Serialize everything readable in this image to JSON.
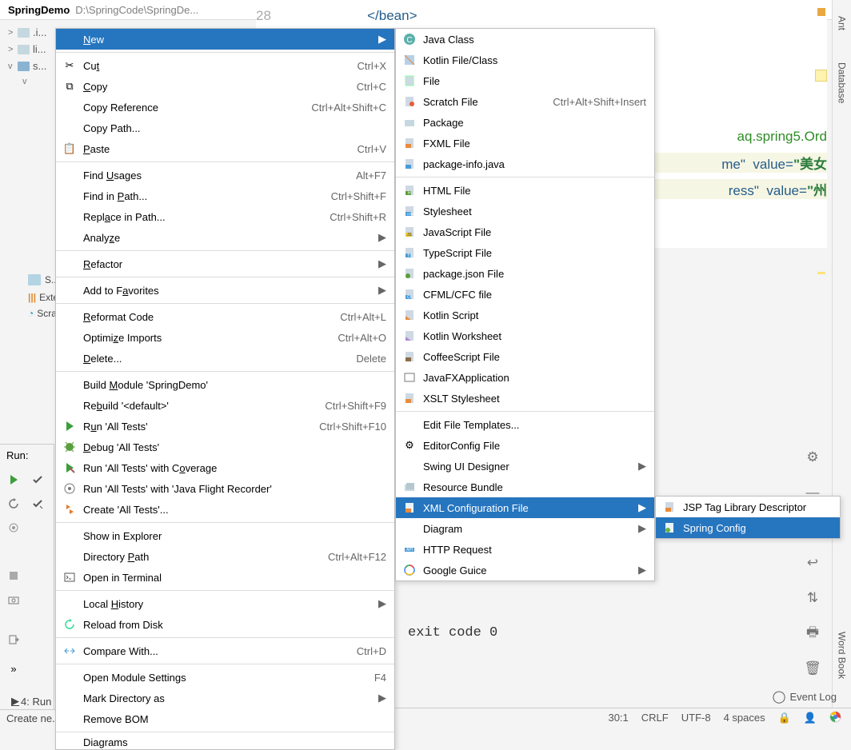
{
  "header": {
    "project": "SpringDemo",
    "path": "D:\\SpringCode\\SpringDe..."
  },
  "tree": {
    "idea": ".i...",
    "lib": "li...",
    "src": "s...",
    "s_label": "S...",
    "external": "Exter...",
    "scratches": "Scrat..."
  },
  "editor": {
    "ln": "28",
    "closebean": "</bean>",
    "pkg": "aq.spring5.Ord",
    "val1": "美女",
    "val2": "州",
    "attr_name": "me\"",
    "attr_addr": "ress\"",
    "kw_value1": "value=",
    "kw_value2": "value="
  },
  "run_panel": {
    "title": "Run:",
    "btn_4run": "4: Run",
    "create": "Create ne..."
  },
  "event_log": "Event Log",
  "status": {
    "pos": "30:1",
    "crlf": "CRLF",
    "enc": "UTF-8",
    "indent": "4 spaces"
  },
  "right_tabs": {
    "ant": "Ant",
    "db": "Database",
    "wb": "Word Book"
  },
  "exit": "exit code 0",
  "ctx": {
    "new": "New",
    "cut": "Cut",
    "copy": "Copy",
    "copyref": "Copy Reference",
    "copypath": "Copy Path...",
    "paste": "Paste",
    "findusages": "Find Usages",
    "findinpath": "Find in Path...",
    "replaceinpath": "Replace in Path...",
    "analyze": "Analyze",
    "refactor": "Refactor",
    "addfav": "Add to Favorites",
    "reformat": "Reformat Code",
    "optimize": "Optimize Imports",
    "delete": "Delete...",
    "buildmod": "Build Module 'SpringDemo'",
    "rebuild": "Rebuild '<default>'",
    "run": "Run 'All Tests'",
    "debug": "Debug 'All Tests'",
    "coverage": "Run 'All Tests' with Coverage",
    "flight": "Run 'All Tests' with 'Java Flight Recorder'",
    "create_tests": "Create 'All Tests'...",
    "showexpl": "Show in Explorer",
    "dirpath": "Directory Path",
    "terminal": "Open in Terminal",
    "localhist": "Local History",
    "reload": "Reload from Disk",
    "compare": "Compare With...",
    "openmod": "Open Module Settings",
    "markdir": "Mark Directory as",
    "removebom": "Remove BOM",
    "diagrams": "Diagrams",
    "sc_cut": "Ctrl+X",
    "sc_copy": "Ctrl+C",
    "sc_copyref": "Ctrl+Alt+Shift+C",
    "sc_paste": "Ctrl+V",
    "sc_findusages": "Alt+F7",
    "sc_findinpath": "Ctrl+Shift+F",
    "sc_replaceinpath": "Ctrl+Shift+R",
    "sc_reformat": "Ctrl+Alt+L",
    "sc_optimize": "Ctrl+Alt+O",
    "sc_delete": "Delete",
    "sc_rebuild": "Ctrl+Shift+F9",
    "sc_run": "Ctrl+Shift+F10",
    "sc_dirpath": "Ctrl+Alt+F12",
    "sc_compare": "Ctrl+D",
    "sc_openmod": "F4"
  },
  "sub": {
    "javaclass": "Java Class",
    "kotlinclass": "Kotlin File/Class",
    "file": "File",
    "scratch": "Scratch File",
    "package": "Package",
    "fxml": "FXML File",
    "pkginfo": "package-info.java",
    "html": "HTML File",
    "stylesheet": "Stylesheet",
    "js": "JavaScript File",
    "ts": "TypeScript File",
    "packagejson": "package.json File",
    "cfml": "CFML/CFC file",
    "kotlinscript": "Kotlin Script",
    "kotlinws": "Kotlin Worksheet",
    "coffeescript": "CoffeeScript File",
    "javafx": "JavaFXApplication",
    "xslt": "XSLT Stylesheet",
    "edittmpl": "Edit File Templates...",
    "editorconfig": "EditorConfig File",
    "swing": "Swing UI Designer",
    "resource": "Resource Bundle",
    "xmlconfig": "XML Configuration File",
    "diagram": "Diagram",
    "httpreq": "HTTP Request",
    "guice": "Google Guice",
    "sc_scratch": "Ctrl+Alt+Shift+Insert"
  },
  "sub2": {
    "jsp": "JSP Tag Library Descriptor",
    "spring": "Spring Config"
  }
}
